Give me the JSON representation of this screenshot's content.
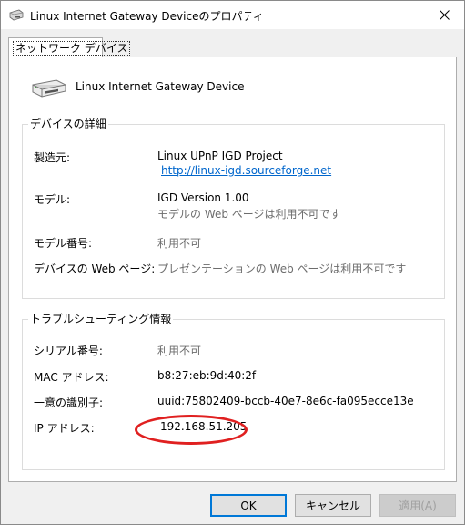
{
  "window": {
    "title": "Linux Internet Gateway Deviceのプロパティ"
  },
  "tabs": [
    {
      "label": "ネットワーク デバイス"
    }
  ],
  "device": {
    "name": "Linux Internet Gateway Device"
  },
  "details": {
    "title": "デバイスの詳細",
    "manufacturer_label": "製造元:",
    "manufacturer_value": "Linux UPnP IGD Project",
    "manufacturer_link": "http://linux-igd.sourceforge.net",
    "model_label": "モデル:",
    "model_value": "IGD Version 1.00",
    "model_page": "モデルの Web ページは利用不可です",
    "model_number_label": "モデル番号:",
    "model_number_value": "利用不可",
    "device_page_label": "デバイスの Web ページ:",
    "device_page_value": "プレゼンテーションの Web ページは利用不可です"
  },
  "troubleshooting": {
    "title": "トラブルシューティング情報",
    "serial_label": "シリアル番号:",
    "serial_value": "利用不可",
    "mac_label": "MAC アドレス:",
    "mac_value": "b8:27:eb:9d:40:2f",
    "uid_label": "一意の識別子:",
    "uid_value": "uuid:75802409-bccb-40e7-8e6c-fa095ecce13e",
    "ip_label": "IP アドレス:",
    "ip_value": "192.168.51.205"
  },
  "buttons": {
    "ok": "OK",
    "cancel": "キャンセル",
    "apply": "適用(A)"
  },
  "colors": {
    "accent": "#0078d7",
    "annotation": "#e02020",
    "link": "#0066cc"
  }
}
